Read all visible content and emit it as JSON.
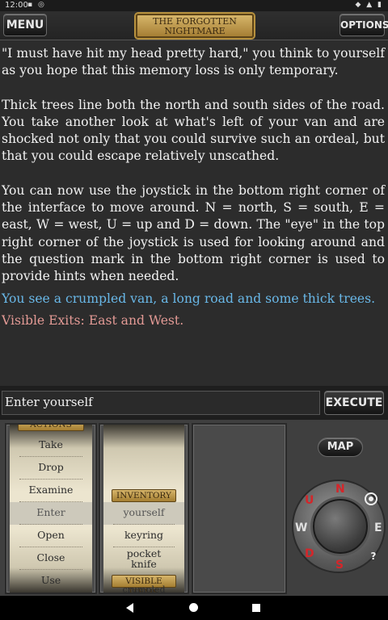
{
  "status": {
    "time": "12:00",
    "left_icons": "▪ ◎",
    "right_icons": "◆ ▲ ▮"
  },
  "topbar": {
    "menu_label": "MENU",
    "options_label": "OPTIONS",
    "title_line1": "THE FORGOTTEN",
    "title_line2": "NIGHTMARE"
  },
  "story": {
    "p1": "\"I must have hit my head pretty hard,\" you think to yourself as you hope that this memory loss is only temporary.",
    "p2": "Thick trees line both the north and south sides of the road. You take another look at what's left of your van and are shocked not only that you could survive such an ordeal, but that you could escape relatively unscathed.",
    "p3": "You can now use the joystick in the bottom right corner of the interface to move around. N = north, S = south, E = east, W = west, U = up and D = down. The \"eye\" in the top right corner of the joystick is used for looking around and the question mark in the bottom right corner is used to provide hints when needed.",
    "you_see": "You see  a crumpled van, a long road and some thick trees.",
    "exits": "Visible Exits:  East and West."
  },
  "command": {
    "value": "Enter yourself",
    "execute_label": "EXECUTE"
  },
  "verbs": {
    "top_label": "ACTIONS",
    "items": [
      "Take",
      "Drop",
      "Examine",
      "Enter",
      "Open",
      "Close",
      "Use"
    ],
    "selected": "Enter"
  },
  "inventory": {
    "label": "INVENTORY",
    "items": [
      "yourself",
      "keyring"
    ],
    "item_pocket_line1": "pocket",
    "item_pocket_line2": "knife",
    "visible_label": "VISIBLE ITEMS",
    "visible_partial": "crumpled",
    "selected": "yourself"
  },
  "map_label": "MAP",
  "joystick": {
    "n": "N",
    "s": "S",
    "e": "E",
    "w": "W",
    "u": "U",
    "d": "D",
    "hint": "?"
  },
  "colors": {
    "text": "#f2f2f2",
    "you_see": "#69b8e8",
    "exits": "#e39a95",
    "brass": "#c9a455",
    "direction_red": "#d4262a"
  }
}
